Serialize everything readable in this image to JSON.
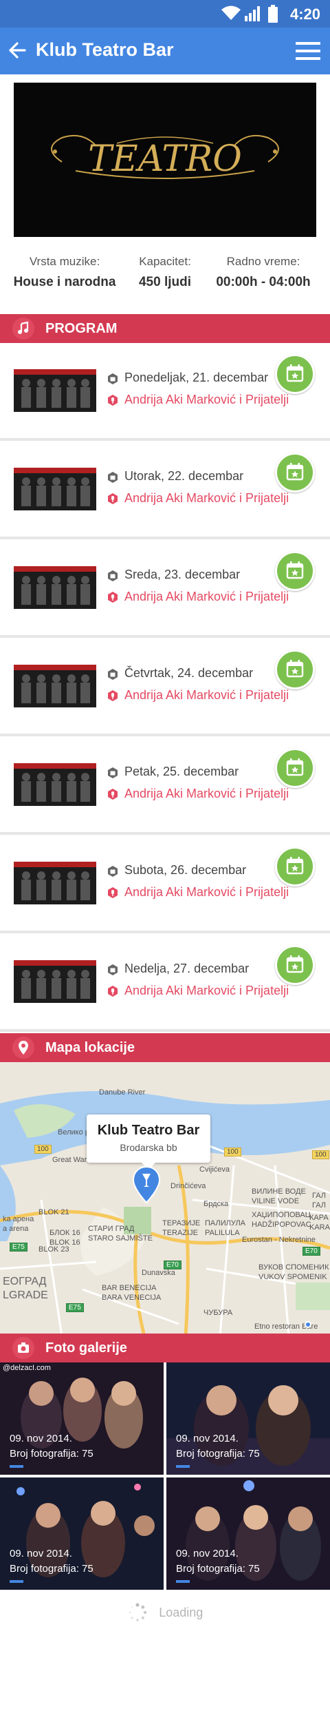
{
  "status_bar": {
    "time": "4:20"
  },
  "header": {
    "title": "Klub Teatro Bar"
  },
  "hero": {
    "logo_text": "TEATRO"
  },
  "info": [
    {
      "label": "Vrsta muzike:",
      "value": "House i narodna"
    },
    {
      "label": "Kapacitet:",
      "value": "450 ljudi"
    },
    {
      "label": "Radno vreme:",
      "value": "00:00h - 04:00h"
    }
  ],
  "program": {
    "heading": "PROGRAM",
    "events": [
      {
        "date": "Ponedeljak, 21. decembar",
        "performer": "Andrija Aki Marković i Prijatelji"
      },
      {
        "date": "Utorak, 22. decembar",
        "performer": "Andrija Aki Marković i Prijatelji"
      },
      {
        "date": "Sreda, 23. decembar",
        "performer": "Andrija Aki Marković i Prijatelji"
      },
      {
        "date": "Četvrtak, 24. decembar",
        "performer": "Andrija Aki Marković i Prijatelji"
      },
      {
        "date": "Petak, 25. decembar",
        "performer": "Andrija Aki Marković i Prijatelji"
      },
      {
        "date": "Subota, 26. decembar",
        "performer": "Andrija Aki Marković i Prijatelji"
      },
      {
        "date": "Nedelja, 27. decembar",
        "performer": "Andrija Aki Marković i Prijatelji"
      }
    ]
  },
  "map_section": {
    "heading": "Mapa lokacije",
    "callout_name": "Klub Teatro Bar",
    "callout_address": "Brodarska bb",
    "labels": [
      "Danube River",
      "Велико ратно острво",
      "Great War Island",
      "ВИЛИНЕ ВОДЕ",
      "VILINE VODE",
      "ХАЏИПОПОВАЦ",
      "HADŽIPOPOVAC",
      "Eurostan - Nekretnine",
      "TERAZIJE",
      "ТЕРАЗИЈЕ",
      "ПАЛИЛУЛА",
      "PALILULA",
      "СТАРИ ГРАД",
      "STARO SAJMIŠTE",
      "ВУКОВ СПОМЕНИК",
      "VUKOV SPOMENIK",
      "ЧУБУРА",
      "Etno restoran Bare",
      "ЕОГРАД",
      "LGRADE",
      "ka арена",
      "a arena",
      "BLOK 21",
      "BLOK 23",
      "БЛОК 16",
      "BLOK 16",
      "BAR BENECIJA",
      "BARA VENECIJA",
      "Dunavska",
      "Cvijićeva",
      "Drinčićeva",
      "Брдска",
      "ГАЛ",
      "ГАЛ",
      "КАРА",
      "KARA"
    ],
    "road_shields": [
      "100",
      "100",
      "100",
      "E75",
      "E70",
      "E70",
      "E75"
    ]
  },
  "gallery": {
    "heading": "Foto galerije",
    "photos": [
      {
        "date": "09. nov 2014.",
        "count": "Broj fotografija: 75",
        "site": "@delzacI.com"
      },
      {
        "date": "09. nov 2014.",
        "count": "Broj fotografija: 75",
        "site": ""
      },
      {
        "date": "09. nov 2014.",
        "count": "Broj fotografija: 75",
        "site": ""
      },
      {
        "date": "09. nov 2014.",
        "count": "Broj fotografija: 75",
        "site": ""
      }
    ]
  },
  "loading": {
    "text": "Loading"
  },
  "colors": {
    "primary": "#4386e2",
    "status": "#3a74c9",
    "accent": "#d33a52",
    "calendar": "#7cc14e",
    "performer": "#e44a62"
  }
}
